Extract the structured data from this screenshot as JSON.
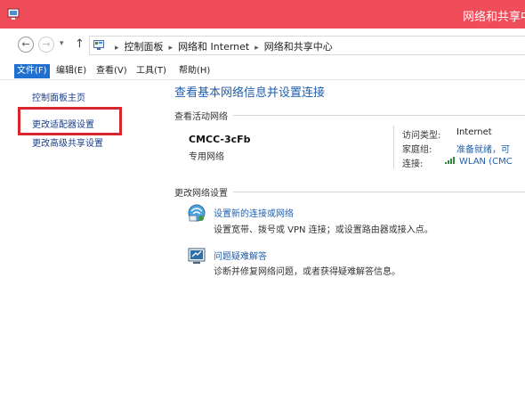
{
  "window": {
    "title": "网络和共享中心"
  },
  "address_bar": {
    "back": "←",
    "forward": "→",
    "dropdown": "▾",
    "up": "↑",
    "crumbs": [
      "控制面板",
      "网络和 Internet",
      "网络和共享中心"
    ],
    "separator": "▸"
  },
  "menu": {
    "items": [
      "文件(F)",
      "编辑(E)",
      "查看(V)",
      "工具(T)",
      "帮助(H)"
    ]
  },
  "sidebar": {
    "items": [
      "控制面板主页",
      "更改适配器设置",
      "更改高级共享设置"
    ]
  },
  "main": {
    "title": "查看基本网络信息并设置连接",
    "active_networks_heading": "查看活动网络",
    "network": {
      "name": "CMCC-3cFb",
      "type": "专用网络",
      "access_type_label": "访问类型:",
      "access_type_value": "Internet",
      "homegroup_label": "家庭组:",
      "homegroup_value": "准备就绪，可",
      "connection_label": "连接:",
      "connection_value": "WLAN (CMC"
    },
    "change_settings_heading": "更改网络设置",
    "tasks": [
      {
        "icon": "network-setup-icon",
        "link": "设置新的连接或网络",
        "description": "设置宽带、拨号或 VPN 连接；或设置路由器或接入点。"
      },
      {
        "icon": "troubleshoot-icon",
        "link": "问题疑难解答",
        "description": "诊断并修复网络问题，或者获得疑难解答信息。"
      }
    ]
  },
  "colors": {
    "titlebar": "#f04d5a",
    "link": "#1f5fb0",
    "highlight": "#d8262e",
    "menu_active": "#1f6fd0"
  }
}
